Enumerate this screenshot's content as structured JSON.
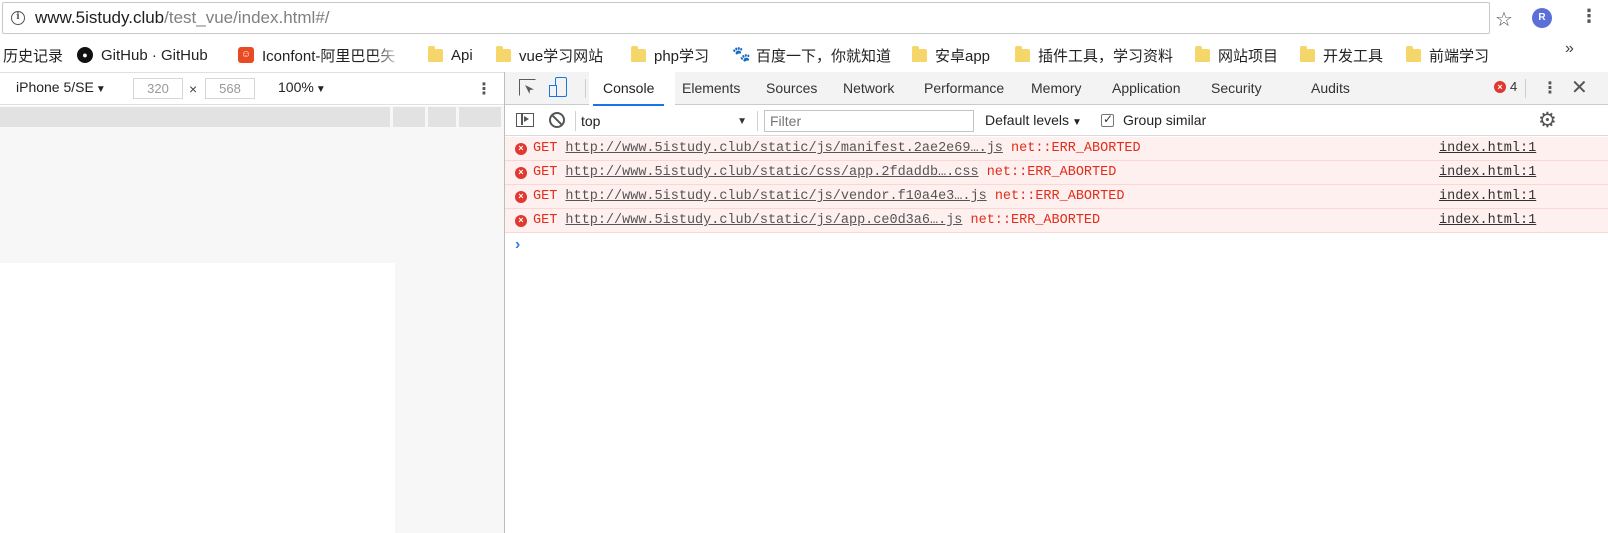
{
  "address_bar": {
    "url_host": "www.5istudy.club",
    "url_path": "/test_vue/index.html#/",
    "profile_initial": "R"
  },
  "bookmarks": {
    "items": [
      {
        "label": "历史记录",
        "icon": "none"
      },
      {
        "label": "GitHub · GitHub",
        "icon": "github-icon"
      },
      {
        "label": "Iconfont-阿里巴巴矢",
        "icon": "iconfont-icon"
      },
      {
        "label": "Api",
        "icon": "folder-icon"
      },
      {
        "label": "vue学习网站",
        "icon": "folder-icon"
      },
      {
        "label": "php学习",
        "icon": "folder-icon"
      },
      {
        "label": "百度一下，你就知道",
        "icon": "baidu-icon"
      },
      {
        "label": "安卓app",
        "icon": "folder-icon"
      },
      {
        "label": "插件工具，学习资料",
        "icon": "folder-icon"
      },
      {
        "label": "网站项目",
        "icon": "folder-icon"
      },
      {
        "label": "开发工具",
        "icon": "folder-icon"
      },
      {
        "label": "前端学习",
        "icon": "folder-icon"
      }
    ],
    "more": "»"
  },
  "device_toolbar": {
    "device": "iPhone 5/SE",
    "width": "320",
    "height": "568",
    "zoom": "100%"
  },
  "devtools": {
    "tabs": [
      "Console",
      "Elements",
      "Sources",
      "Network",
      "Performance",
      "Memory",
      "Application",
      "Security",
      "Audits"
    ],
    "active_tab": "Console",
    "error_count": "4",
    "console_toolbar": {
      "context": "top",
      "filter_placeholder": "Filter",
      "levels": "Default levels",
      "group_similar": "Group similar",
      "group_similar_checked": true
    },
    "messages": [
      {
        "method": "GET",
        "url": "http://www.5istudy.club/static/js/manifest.2ae2e69….js",
        "error": "net::ERR_ABORTED",
        "source": "index.html:1"
      },
      {
        "method": "GET",
        "url": "http://www.5istudy.club/static/css/app.2fdaddb….css",
        "error": "net::ERR_ABORTED",
        "source": "index.html:1"
      },
      {
        "method": "GET",
        "url": "http://www.5istudy.club/static/js/vendor.f10a4e3….js",
        "error": "net::ERR_ABORTED",
        "source": "index.html:1"
      },
      {
        "method": "GET",
        "url": "http://www.5istudy.club/static/js/app.ce0d3a6….js",
        "error": "net::ERR_ABORTED",
        "source": "index.html:1"
      }
    ]
  },
  "colors": {
    "accent": "#1a73e8",
    "error_text": "#e12d1c",
    "error_row_bg": "#fef0ef",
    "error_icon": "#e1372f"
  }
}
